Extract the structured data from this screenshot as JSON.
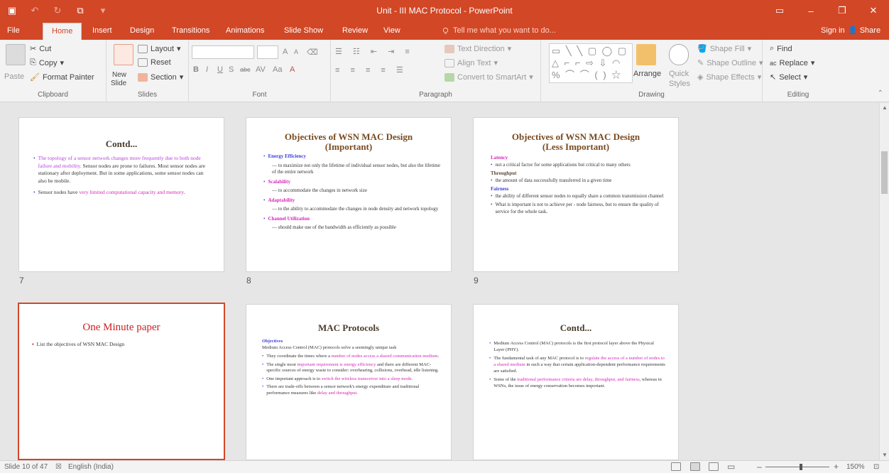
{
  "app": {
    "title": "Unit - III MAC Protocol  -  PowerPoint",
    "window_controls": [
      "▭",
      "–",
      "❐",
      "✕"
    ]
  },
  "tabs": [
    {
      "label": "File"
    },
    {
      "label": "Home"
    },
    {
      "label": "Insert"
    },
    {
      "label": "Design"
    },
    {
      "label": "Transitions"
    },
    {
      "label": "Animations"
    },
    {
      "label": "Slide Show"
    },
    {
      "label": "Review"
    },
    {
      "label": "View"
    }
  ],
  "tellme": "Tell me what you want to do...",
  "signin": "Sign in",
  "share": "Share",
  "ribbon": {
    "clipboard": {
      "paste": "Paste",
      "cut": "Cut",
      "copy": "Copy",
      "format_painter": "Format Painter",
      "label": "Clipboard"
    },
    "slides": {
      "new_slide": "New",
      "new_slide2": "Slide",
      "layout": "Layout",
      "reset": "Reset",
      "section": "Section",
      "label": "Slides"
    },
    "font": {
      "b": "B",
      "i": "I",
      "u": "U",
      "s": "S",
      "abc": "abc",
      "av": "AV",
      "aa": "Aa",
      "grow": "A",
      "shrink": "A",
      "label": "Font"
    },
    "paragraph": {
      "text_direction": "Text Direction",
      "align_text": "Align Text",
      "convert": "Convert to SmartArt",
      "label": "Paragraph"
    },
    "drawing": {
      "arrange": "Arrange",
      "quick_styles": "Quick",
      "quick_styles2": "Styles",
      "shape_fill": "Shape Fill",
      "shape_outline": "Shape Outline",
      "shape_effects": "Shape Effects",
      "label": "Drawing"
    },
    "editing": {
      "find": "Find",
      "replace": "Replace",
      "select": "Select",
      "label": "Editing"
    }
  },
  "slides": [
    {
      "number": "7",
      "title": "Contd...",
      "bullets": [
        {
          "pre": "",
          "mag": "The topology of a sensor network changes more frequently due to both node failure and mobility.",
          "post": " Sensor nodes are prone to failures. Most sensor nodes are stationary after deployment. But in some applications, some sensor nodes can also be mobile."
        },
        {
          "pre": "Sensor nodes have ",
          "mag": "very limited computational capacity and memory",
          "post": "."
        }
      ]
    },
    {
      "number": "8",
      "title": "Objectives of WSN MAC Design",
      "subtitle": "(Important)",
      "items": [
        {
          "head": "Energy Efficiency",
          "style": "blue",
          "sub": "to maximize not only the lifetime of individual sensor nodes, but also the lifetime of the entire network"
        },
        {
          "head": "Scalability",
          "style": "pink",
          "sub": "to accommodate the changes in network size"
        },
        {
          "head": "Adaptability",
          "style": "pink",
          "sub": "to the ability to accommodate the changes in node density and network topology"
        },
        {
          "head": "Channel Utilization",
          "style": "pink",
          "sub": "should make use of the bandwidth as efficiently as possible"
        }
      ]
    },
    {
      "number": "9",
      "title": "Objectives of WSN MAC Design",
      "subtitle": "(Less Important)",
      "sections": [
        {
          "head": "Latency",
          "style": "pink",
          "points": [
            "not a critical factor for some applications but critical to many others"
          ]
        },
        {
          "head": "Throughput",
          "style": "dark",
          "points": [
            "the amount of data successfully transferred in a given time"
          ]
        },
        {
          "head": "Fairness",
          "style": "blue",
          "points": [
            "the ability of different sensor nodes to equally share a common transmission channel",
            "What is important is not to achieve per - node fairness, but to ensure the quality of service for the whole task."
          ]
        }
      ]
    },
    {
      "number": "10",
      "title": "One Minute paper",
      "bullets": [
        "List the objectives of WSN MAC Design"
      ]
    },
    {
      "number": "11",
      "title": "MAC Protocols",
      "objectives_head": "Objectives",
      "intro": "Medium Access Control (MAC) protocols solve a seemingly unique task",
      "bullets": [
        {
          "pre": "They coordinate the times where a ",
          "mag": "number of nodes access a shared communication medium",
          "post": "."
        },
        {
          "pre": "The single most ",
          "mag": "important requirement is energy efficiency",
          "post": " and there are different MAC-specific sources of energy waste to consider: overhearing, collisions, overhead, idle listening."
        },
        {
          "pre": "One important approach is to ",
          "mag": "switch the wireless transceiver into a sleep mode",
          "post": "."
        },
        {
          "pre": "There are trade-offs between a sensor network's energy expenditure and traditional performance measures like ",
          "mag": "delay and throughput",
          "post": "."
        }
      ]
    },
    {
      "number": "12",
      "title": "Contd...",
      "bullets": [
        {
          "pre": "Medium Access Control (MAC) protocols is the first protocol layer above the Physical Layer (PHY).",
          "mag": "",
          "post": ""
        },
        {
          "pre": "The fundamental task of any MAC protocol is to ",
          "mag": "regulate the access of a number of nodes to a shared medium",
          "post": " in such a way that certain application-dependent performance requirements are satisfied."
        },
        {
          "pre": "Some of the ",
          "mag": "traditional performance criteria are delay, throughput, and fairness",
          "post": ", whereas in WSNs, the issue of energy conservation becomes important."
        }
      ]
    }
  ],
  "status": {
    "slide_info": "Slide 10 of 47",
    "language": "English (India)",
    "zoom": "150%"
  },
  "colors": {
    "accent": "#d24726",
    "selected_border": "#d24726"
  }
}
